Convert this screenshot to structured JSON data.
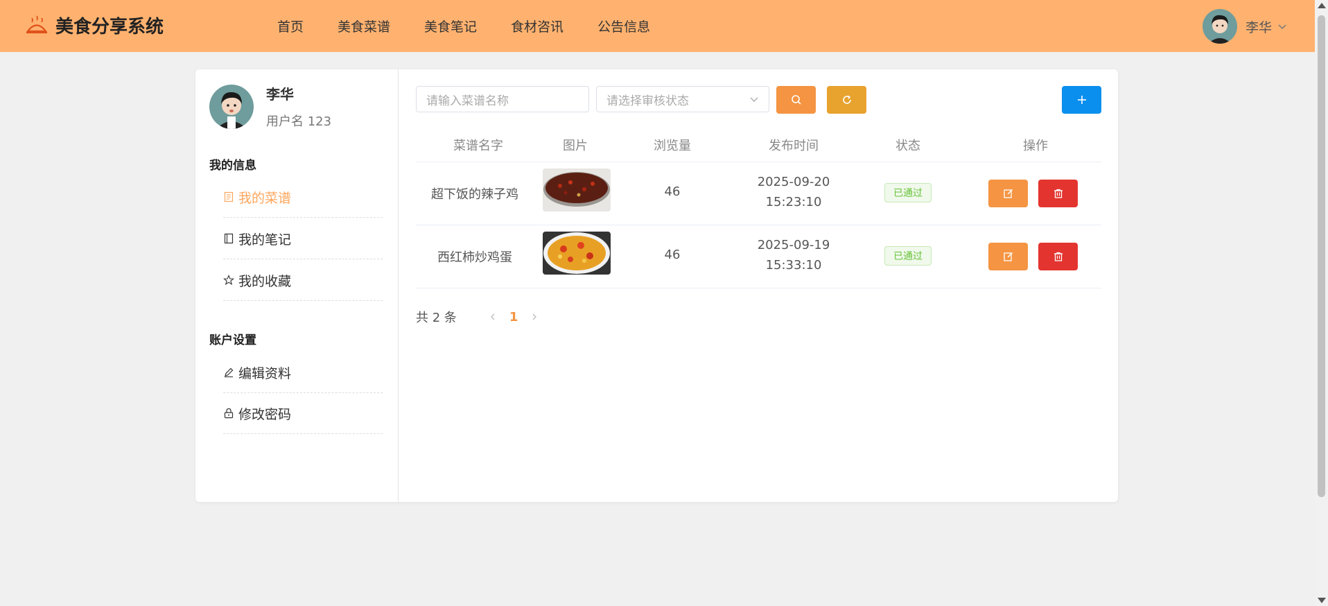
{
  "header": {
    "app_title": "美食分享系统",
    "nav": [
      "首页",
      "美食菜谱",
      "美食笔记",
      "食材咨讯",
      "公告信息"
    ],
    "user_name": "李华"
  },
  "profile": {
    "name": "李华",
    "username_text": "用户名 123"
  },
  "sidebar": {
    "section_info": "我的信息",
    "info_items": [
      {
        "label": "我的菜谱",
        "icon": "document-icon",
        "active": true
      },
      {
        "label": "我的笔记",
        "icon": "notebook-icon",
        "active": false
      },
      {
        "label": "我的收藏",
        "icon": "star-icon",
        "active": false
      }
    ],
    "section_account": "账户设置",
    "account_items": [
      {
        "label": "编辑资料",
        "icon": "edit-icon"
      },
      {
        "label": "修改密码",
        "icon": "lock-icon"
      }
    ]
  },
  "toolbar": {
    "search_placeholder": "请输入菜谱名称",
    "status_placeholder": "请选择审核状态"
  },
  "table": {
    "headers": [
      "菜谱名字",
      "图片",
      "浏览量",
      "发布时间",
      "状态",
      "操作"
    ],
    "rows": [
      {
        "name": "超下饭的辣子鸡",
        "views": "46",
        "date": "2025-09-20",
        "time": "15:23:10",
        "status": "已通过"
      },
      {
        "name": "西红柿炒鸡蛋",
        "views": "46",
        "date": "2025-09-19",
        "time": "15:33:10",
        "status": "已通过"
      }
    ]
  },
  "pagination": {
    "total_text": "共 2 条",
    "current_page": "1"
  },
  "colors": {
    "header_bg": "#ffb26f",
    "search_btn": "#f59442",
    "reset_btn": "#e8a22e",
    "add_btn": "#0a8fee",
    "edit_btn": "#f59442",
    "delete_btn": "#e3342f",
    "status_green": "#67c23a"
  }
}
